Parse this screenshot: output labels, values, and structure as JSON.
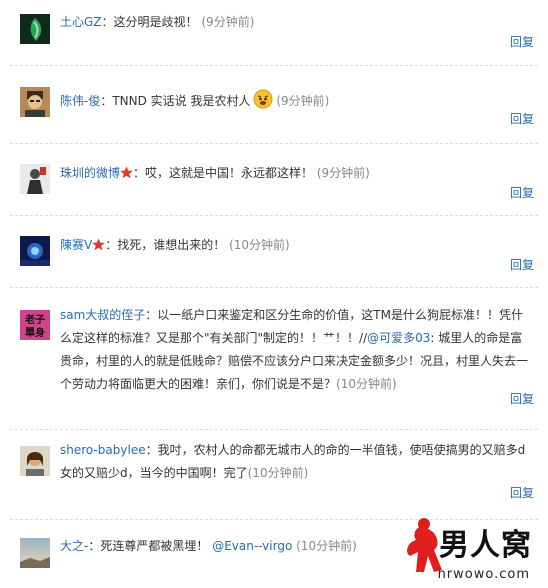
{
  "reply_label": "回复",
  "comments": [
    {
      "user": "土心GZ",
      "text": "：这分明是歧视！",
      "time": "(9分钟前)"
    },
    {
      "user": "陈伟-俊",
      "text": "：TNND 实话说 我是农村人",
      "time": "(9分钟前)",
      "emoji": "angry-face-icon"
    },
    {
      "user": "珠圳的微博",
      "text": "：哎，这就是中国！永远都这样！",
      "time": "(9分钟前)",
      "badge": "star-icon"
    },
    {
      "user": "陳赛V",
      "text": "：找死，谁想出来的！",
      "time": "(10分钟前)",
      "badge": "star-icon"
    },
    {
      "user": "sam大叔的侄子",
      "text_a": "：以一纸户口来鉴定和区分生命的价值，这TM是什么狗屁标准！！凭什么定这样的标准？又是那个\"有关部门\"制定的！！艹！！//",
      "mention": "@可爱多03",
      "text_b": ": 城里人的命是富贵命，村里的人的就是低贱命？赔偿不应该分户口来决定金额多少！况且，村里人失去一个劳动力将面临更大的困难！亲们，你们说是不是？",
      "time": "(10分钟前)",
      "avatar_text": "老子\n單身"
    },
    {
      "user": "shero-babylee",
      "text": "：我吋，农村人的命都无城市人的命的一半值钱，使唔使搞男的又赔多d女的又赔少d，当今的中国啊！完了",
      "time": "(10分钟前)"
    },
    {
      "user": "大之-",
      "text": "：死连尊严都被黑埋！",
      "mention": "@Evan--virgo",
      "time": "(10分钟前)"
    }
  ],
  "watermark": {
    "brand": "男人窝",
    "url": "nrwowo.com"
  },
  "colors": {
    "link": "#2b6cb0",
    "time": "#888888",
    "badge": "#e23a2e"
  }
}
